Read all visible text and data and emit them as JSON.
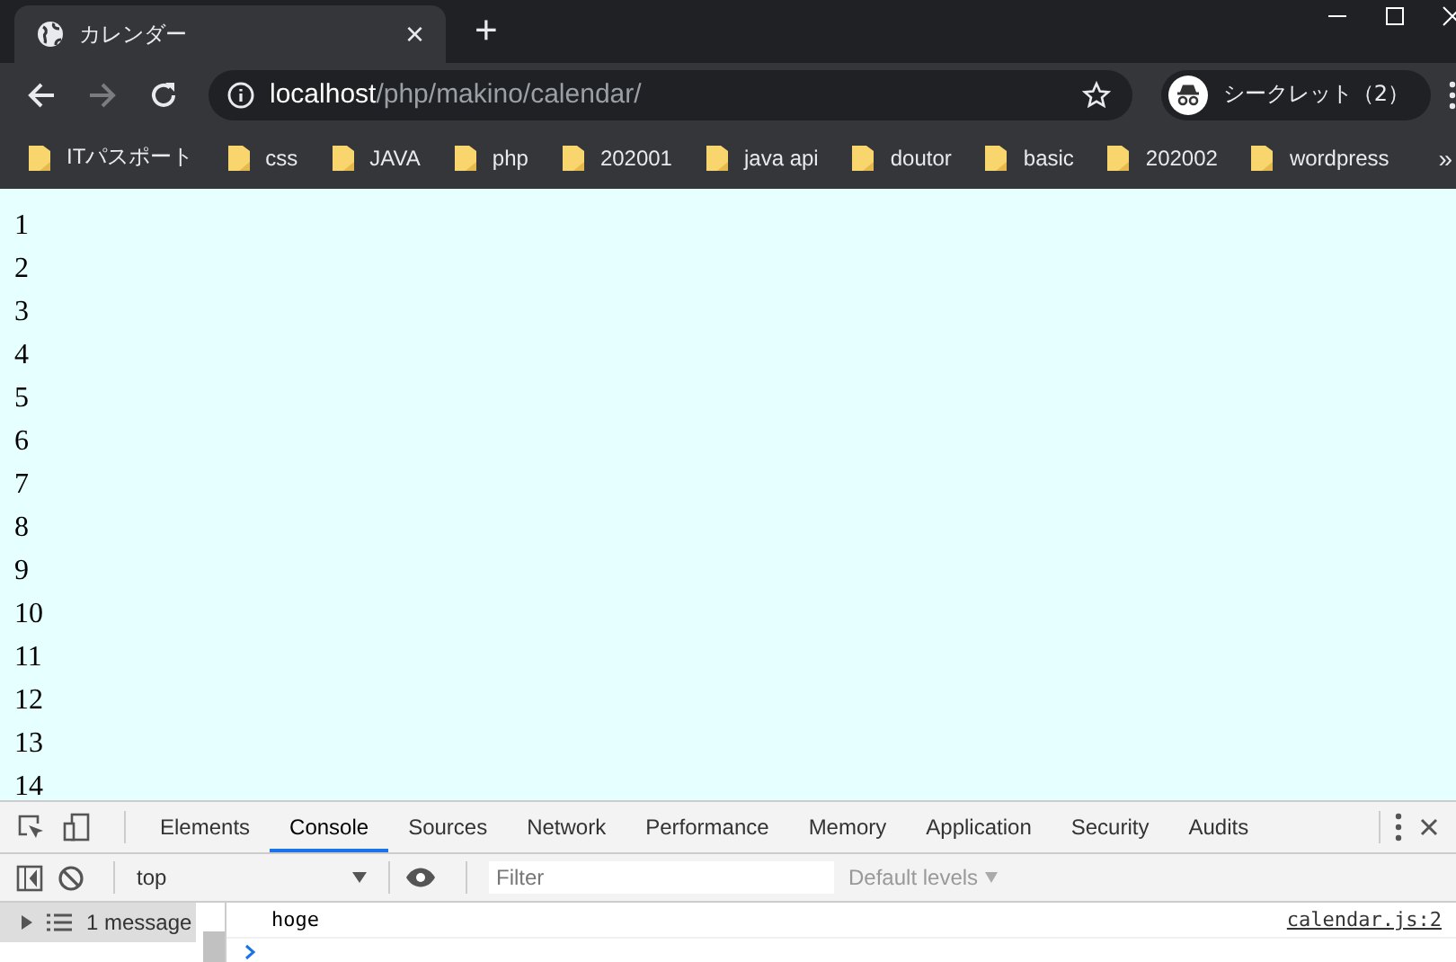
{
  "window": {
    "tab_title": "カレンダー",
    "close": "×",
    "new_tab": "+"
  },
  "toolbar": {
    "url_host": "localhost",
    "url_path": "/php/makino/calendar/",
    "profile": "シークレット（2）"
  },
  "bookmarks": [
    "ITパスポート",
    "css",
    "JAVA",
    "php",
    "202001",
    "java api",
    "doutor",
    "basic",
    "202002",
    "wordpress"
  ],
  "bookmarks_more": "»",
  "page": {
    "lines": [
      "1",
      "2",
      "3",
      "4",
      "5",
      "6",
      "7",
      "8",
      "9",
      "10",
      "11",
      "12",
      "13",
      "14"
    ]
  },
  "devtools": {
    "tabs": [
      {
        "label": "Elements",
        "selected": false
      },
      {
        "label": "Console",
        "selected": true
      },
      {
        "label": "Sources",
        "selected": false
      },
      {
        "label": "Network",
        "selected": false
      },
      {
        "label": "Performance",
        "selected": false
      },
      {
        "label": "Memory",
        "selected": false
      },
      {
        "label": "Application",
        "selected": false
      },
      {
        "label": "Security",
        "selected": false
      },
      {
        "label": "Audits",
        "selected": false
      }
    ],
    "context": "top",
    "filter": {
      "placeholder": "Filter"
    },
    "levels": "Default levels",
    "sidebar": {
      "messages": "1 message",
      "expanded": false
    },
    "console": [
      {
        "text": "hoge",
        "source": "calendar.js:2"
      }
    ]
  }
}
